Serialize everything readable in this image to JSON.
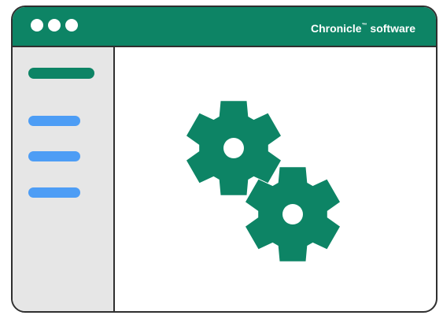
{
  "window": {
    "brand_name": "Chronicle",
    "brand_mark": "™",
    "brand_suffix": "software",
    "controls": [
      "window-dot",
      "window-dot",
      "window-dot"
    ]
  },
  "sidebar": {
    "items": [
      {
        "kind": "active",
        "color": "#0d8465"
      },
      {
        "kind": "menu",
        "color": "#4d9df5"
      },
      {
        "kind": "menu",
        "color": "#4d9df5"
      },
      {
        "kind": "menu",
        "color": "#4d9df5"
      }
    ]
  },
  "main": {
    "icons": [
      "gear-icon",
      "gear-icon"
    ],
    "icon_color": "#0d8465"
  },
  "colors": {
    "accent": "#0d8465",
    "sidebar_bg": "#e6e6e6",
    "menu_bar": "#4d9df5",
    "border": "#2f2f2f"
  }
}
